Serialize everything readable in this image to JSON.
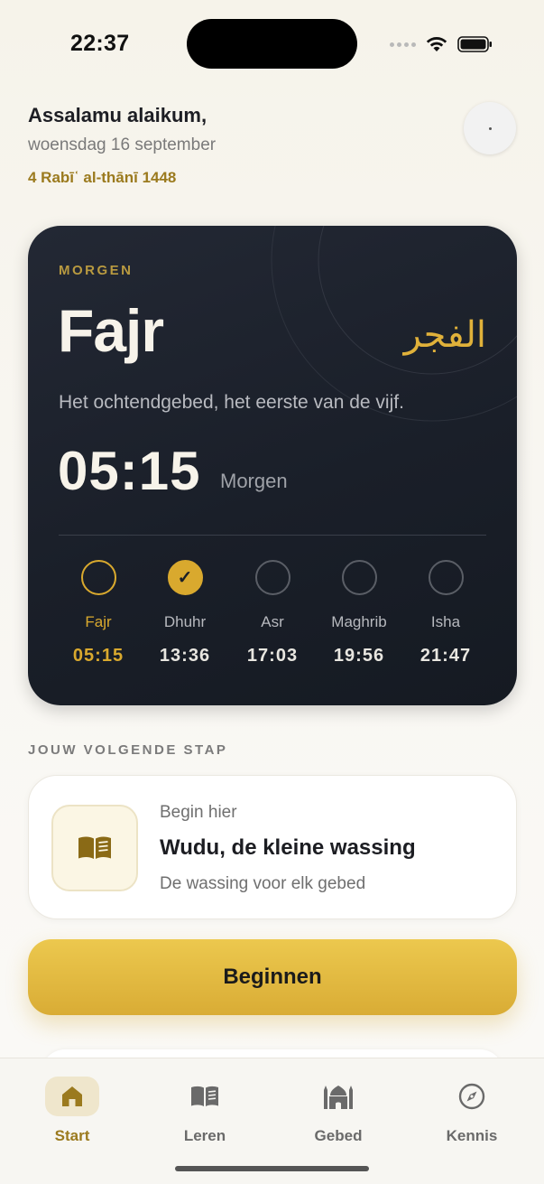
{
  "status_bar": {
    "time": "22:37"
  },
  "header": {
    "greeting": "Assalamu alaikum,",
    "date": "woensdag 16 september",
    "hijri_date": "4 Rabīʿ al-thānī 1448"
  },
  "prayer_card": {
    "label": "MORGEN",
    "title": "Fajr",
    "arabic": "الفجر",
    "description": "Het ochtendgebed, het eerste van de vijf.",
    "time": "05:15",
    "when": "Morgen",
    "prayers": [
      {
        "name": "Fajr",
        "time": "05:15",
        "state": "current"
      },
      {
        "name": "Dhuhr",
        "time": "13:36",
        "state": "done"
      },
      {
        "name": "Asr",
        "time": "17:03",
        "state": "pending"
      },
      {
        "name": "Maghrib",
        "time": "19:56",
        "state": "pending"
      },
      {
        "name": "Isha",
        "time": "21:47",
        "state": "pending"
      }
    ],
    "check_glyph": "✓"
  },
  "next_step": {
    "section_title": "JOUW VOLGENDE STAP",
    "kicker": "Begin hier",
    "title": "Wudu, de kleine wassing",
    "subtitle": "De wassing voor elk gebed",
    "icon": "book-icon"
  },
  "cta": {
    "label": "Beginnen"
  },
  "tab_bar": {
    "tabs": [
      {
        "label": "Start",
        "icon": "home-icon",
        "active": true
      },
      {
        "label": "Leren",
        "icon": "book-icon",
        "active": false
      },
      {
        "label": "Gebed",
        "icon": "mosque-icon",
        "active": false
      },
      {
        "label": "Kennis",
        "icon": "compass-icon",
        "active": false
      }
    ]
  },
  "colors": {
    "accent": "#d9a92e",
    "accent_text": "#9b7a1e",
    "card_bg": "#1a1f29"
  }
}
